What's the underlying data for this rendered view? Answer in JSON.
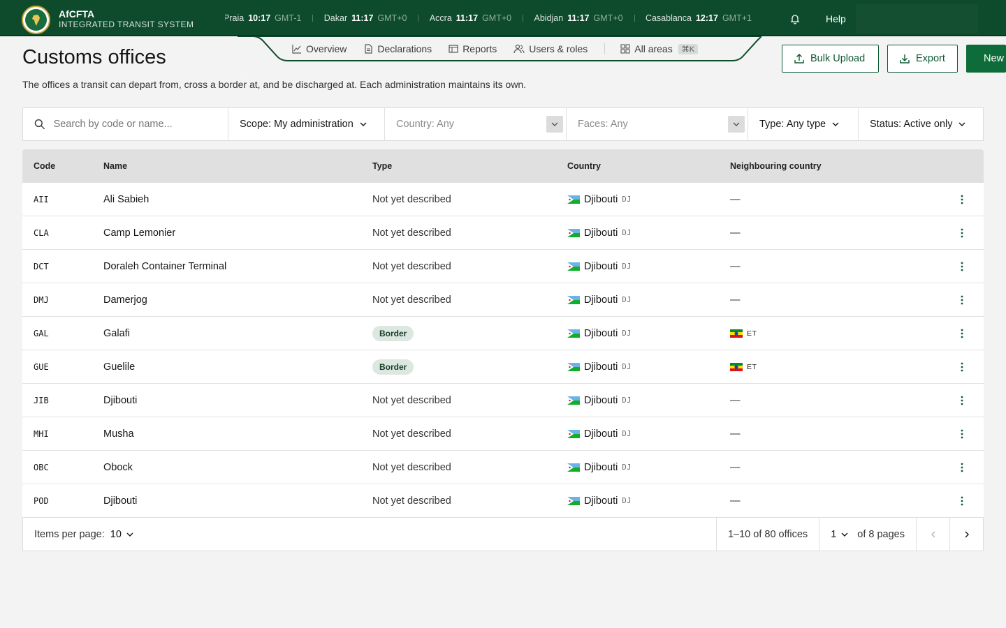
{
  "app": {
    "name": "AfCFTA",
    "subtitle": "INTEGRATED TRANSIT SYSTEM"
  },
  "clocks": [
    {
      "city": "Praia",
      "time": "10:17",
      "tz": "GMT-1"
    },
    {
      "city": "Dakar",
      "time": "11:17",
      "tz": "GMT+0"
    },
    {
      "city": "Accra",
      "time": "11:17",
      "tz": "GMT+0"
    },
    {
      "city": "Abidjan",
      "time": "11:17",
      "tz": "GMT+0"
    },
    {
      "city": "Casablanca",
      "time": "12:17",
      "tz": "GMT+1"
    }
  ],
  "header": {
    "help": "Help"
  },
  "nav": {
    "overview": "Overview",
    "declarations": "Declarations",
    "reports": "Reports",
    "users": "Users & roles",
    "all_areas": "All areas",
    "shortcut": "⌘K"
  },
  "page": {
    "title": "Customs offices",
    "description": "The offices a transit can depart from, cross a border at, and be discharged at. Each administration maintains its own.",
    "bulk_upload": "Bulk Upload",
    "export": "Export",
    "new": "New"
  },
  "filters": {
    "search_placeholder": "Search by code or name...",
    "scope": "Scope: My administration",
    "country": "Country: Any",
    "faces": "Faces: Any",
    "type": "Type: Any type",
    "status": "Status: Active only"
  },
  "table": {
    "columns": {
      "code": "Code",
      "name": "Name",
      "type": "Type",
      "country": "Country",
      "neighbour": "Neighbouring country"
    },
    "rows": [
      {
        "code": "AII",
        "name": "Ali Sabieh",
        "type": "Not yet described",
        "is_tag": false,
        "country": "Djibouti",
        "iso": "DJ",
        "neighbour": "—"
      },
      {
        "code": "CLA",
        "name": "Camp Lemonier",
        "type": "Not yet described",
        "is_tag": false,
        "country": "Djibouti",
        "iso": "DJ",
        "neighbour": "—"
      },
      {
        "code": "DCT",
        "name": "Doraleh Container Terminal",
        "type": "Not yet described",
        "is_tag": false,
        "country": "Djibouti",
        "iso": "DJ",
        "neighbour": "—"
      },
      {
        "code": "DMJ",
        "name": "Damerjog",
        "type": "Not yet described",
        "is_tag": false,
        "country": "Djibouti",
        "iso": "DJ",
        "neighbour": "—"
      },
      {
        "code": "GAL",
        "name": "Galafi",
        "type": "Border",
        "is_tag": true,
        "country": "Djibouti",
        "iso": "DJ",
        "neighbour": "ET"
      },
      {
        "code": "GUE",
        "name": "Guelile",
        "type": "Border",
        "is_tag": true,
        "country": "Djibouti",
        "iso": "DJ",
        "neighbour": "ET"
      },
      {
        "code": "JIB",
        "name": "Djibouti",
        "type": "Not yet described",
        "is_tag": false,
        "country": "Djibouti",
        "iso": "DJ",
        "neighbour": "—"
      },
      {
        "code": "MHI",
        "name": "Musha",
        "type": "Not yet described",
        "is_tag": false,
        "country": "Djibouti",
        "iso": "DJ",
        "neighbour": "—"
      },
      {
        "code": "OBC",
        "name": "Obock",
        "type": "Not yet described",
        "is_tag": false,
        "country": "Djibouti",
        "iso": "DJ",
        "neighbour": "—"
      },
      {
        "code": "POD",
        "name": "Djibouti",
        "type": "Not yet described",
        "is_tag": false,
        "country": "Djibouti",
        "iso": "DJ",
        "neighbour": "—"
      }
    ]
  },
  "pagination": {
    "items_label": "Items per page:",
    "items_value": "10",
    "range": "1–10 of 80 offices",
    "page": "1",
    "of_pages": "of 8 pages"
  },
  "colors": {
    "brand": "#0e4a2c",
    "primary": "#0e6b3a",
    "tag_bg": "#dde7e1"
  },
  "icons": {
    "logo": "africa-seal",
    "bell": "bell-icon",
    "menu": "overflow-menu-icon"
  }
}
